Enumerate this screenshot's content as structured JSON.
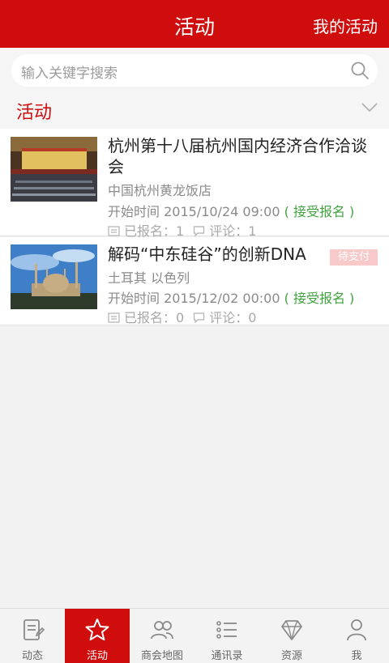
{
  "header": {
    "title": "活动",
    "right_action": "我的活动"
  },
  "search": {
    "placeholder": "输入关键字搜索",
    "icon": "search-icon"
  },
  "section": {
    "title": "活动",
    "icon": "chevron-down-icon"
  },
  "events": [
    {
      "title": "杭州第十八届杭州国内经济合作洽谈会",
      "location": "中国杭州黄龙饭店",
      "start_time": "开始时间 2015/10/24 09:00",
      "status": "( 接受报名 )",
      "signup": "已报名：1",
      "comments": "评论：1"
    },
    {
      "title": "解码“中东硅谷”的创新DNA",
      "badge": "待支付",
      "location": "土耳其 以色列",
      "start_time": "开始时间 2015/12/02 00:00",
      "status": "( 接受报名 )",
      "signup": "已报名：0",
      "comments": "评论：0"
    }
  ],
  "tabs": [
    {
      "label": "动态",
      "icon": "news-icon"
    },
    {
      "label": "活动",
      "icon": "star-icon"
    },
    {
      "label": "商会地图",
      "icon": "people-icon"
    },
    {
      "label": "通讯录",
      "icon": "list-icon"
    },
    {
      "label": "资源",
      "icon": "diamond-icon"
    },
    {
      "label": "我",
      "icon": "user-icon"
    }
  ],
  "colors": {
    "brand": "#d00d0d",
    "status_green": "#3ea33e",
    "badge_pink": "#f8c9c9"
  }
}
